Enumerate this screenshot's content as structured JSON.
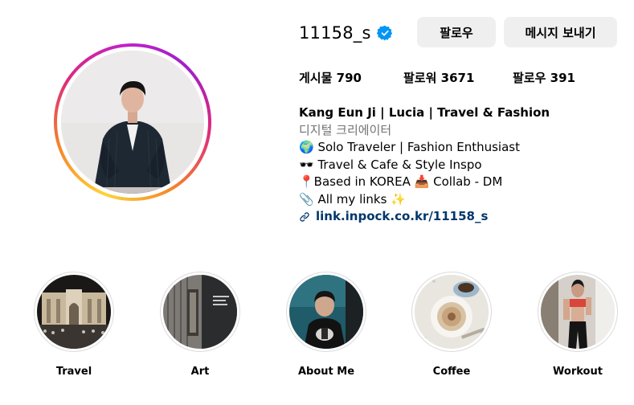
{
  "profile": {
    "username": "11158_s",
    "verified_icon": "verified-badge-icon",
    "follow_label": "팔로우",
    "message_label": "메시지 보내기"
  },
  "stats": {
    "posts_label": "게시물",
    "posts_count": "790",
    "followers_label": "팔로워",
    "followers_count": "3671",
    "following_label": "팔로우",
    "following_count": "391"
  },
  "bio": {
    "name": "Kang Eun Ji | Lucia | Travel & Fashion",
    "category": "디지털 크리에이터",
    "line1": "🌍 Solo Traveler | Fashion Enthusiast",
    "line2": "🕶️ Travel & Cafe & Style Inspo",
    "line3": "📍Based in KOREA 📥 Collab - DM",
    "line4": "📎 All my links ✨",
    "link": "link.inpock.co.kr/11158_s"
  },
  "highlights": [
    {
      "label": "Travel"
    },
    {
      "label": "Art"
    },
    {
      "label": "About Me"
    },
    {
      "label": "Coffee"
    },
    {
      "label": "Workout"
    }
  ]
}
